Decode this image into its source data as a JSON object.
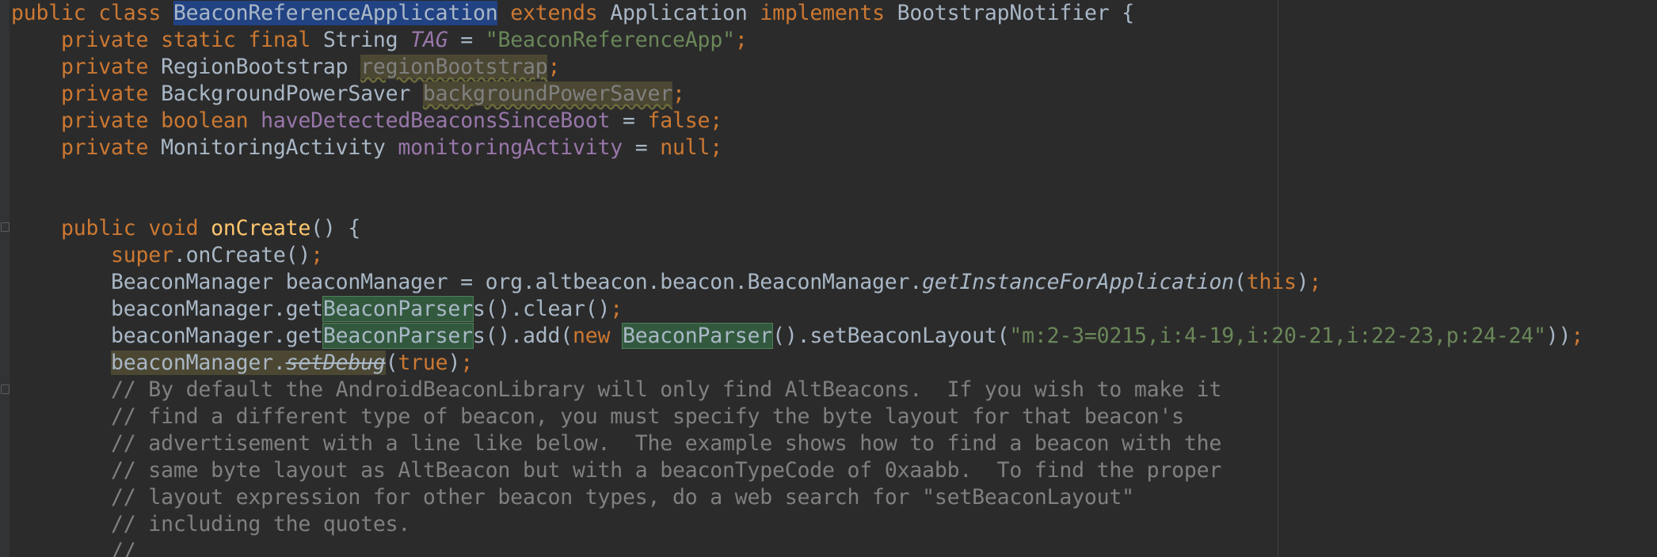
{
  "editor": {
    "language": "java",
    "colors": {
      "background": "#2b2b2b",
      "keyword": "#cc7832",
      "string": "#6a8759",
      "field": "#9876aa",
      "method_decl": "#ffc66d",
      "comment": "#808080",
      "default": "#a9b7c6",
      "selection": "#214283"
    },
    "lines": [
      {
        "text": "public class BeaconReferenceApplication extends Application implements BootstrapNotifier {"
      },
      {
        "text": "    private static final String TAG = \"BeaconReferenceApp\";"
      },
      {
        "text": "    private RegionBootstrap regionBootstrap;"
      },
      {
        "text": "    private BackgroundPowerSaver backgroundPowerSaver;"
      },
      {
        "text": "    private boolean haveDetectedBeaconsSinceBoot = false;"
      },
      {
        "text": "    private MonitoringActivity monitoringActivity = null;"
      },
      {
        "text": ""
      },
      {
        "text": ""
      },
      {
        "text": "    public void onCreate() {"
      },
      {
        "text": "        super.onCreate();"
      },
      {
        "text": "        BeaconManager beaconManager = org.altbeacon.beacon.BeaconManager.getInstanceForApplication(this);"
      },
      {
        "text": "        beaconManager.getBeaconParsers().clear();"
      },
      {
        "text": "        beaconManager.getBeaconParsers().add(new BeaconParser().setBeaconLayout(\"m:2-3=0215,i:4-19,i:20-21,i:22-23,p:24-24\"));"
      },
      {
        "text": "        beaconManager.setDebug(true);"
      },
      {
        "text": "        // By default the AndroidBeaconLibrary will only find AltBeacons.  If you wish to make it"
      },
      {
        "text": "        // find a different type of beacon, you must specify the byte layout for that beacon's"
      },
      {
        "text": "        // advertisement with a line like below.  The example shows how to find a beacon with the"
      },
      {
        "text": "        // same byte layout as AltBeacon but with a beaconTypeCode of 0xaabb.  To find the proper"
      },
      {
        "text": "        // layout expression for other beacon types, do a web search for \"setBeaconLayout\""
      },
      {
        "text": "        // including the quotes."
      },
      {
        "text": "        //"
      }
    ]
  }
}
